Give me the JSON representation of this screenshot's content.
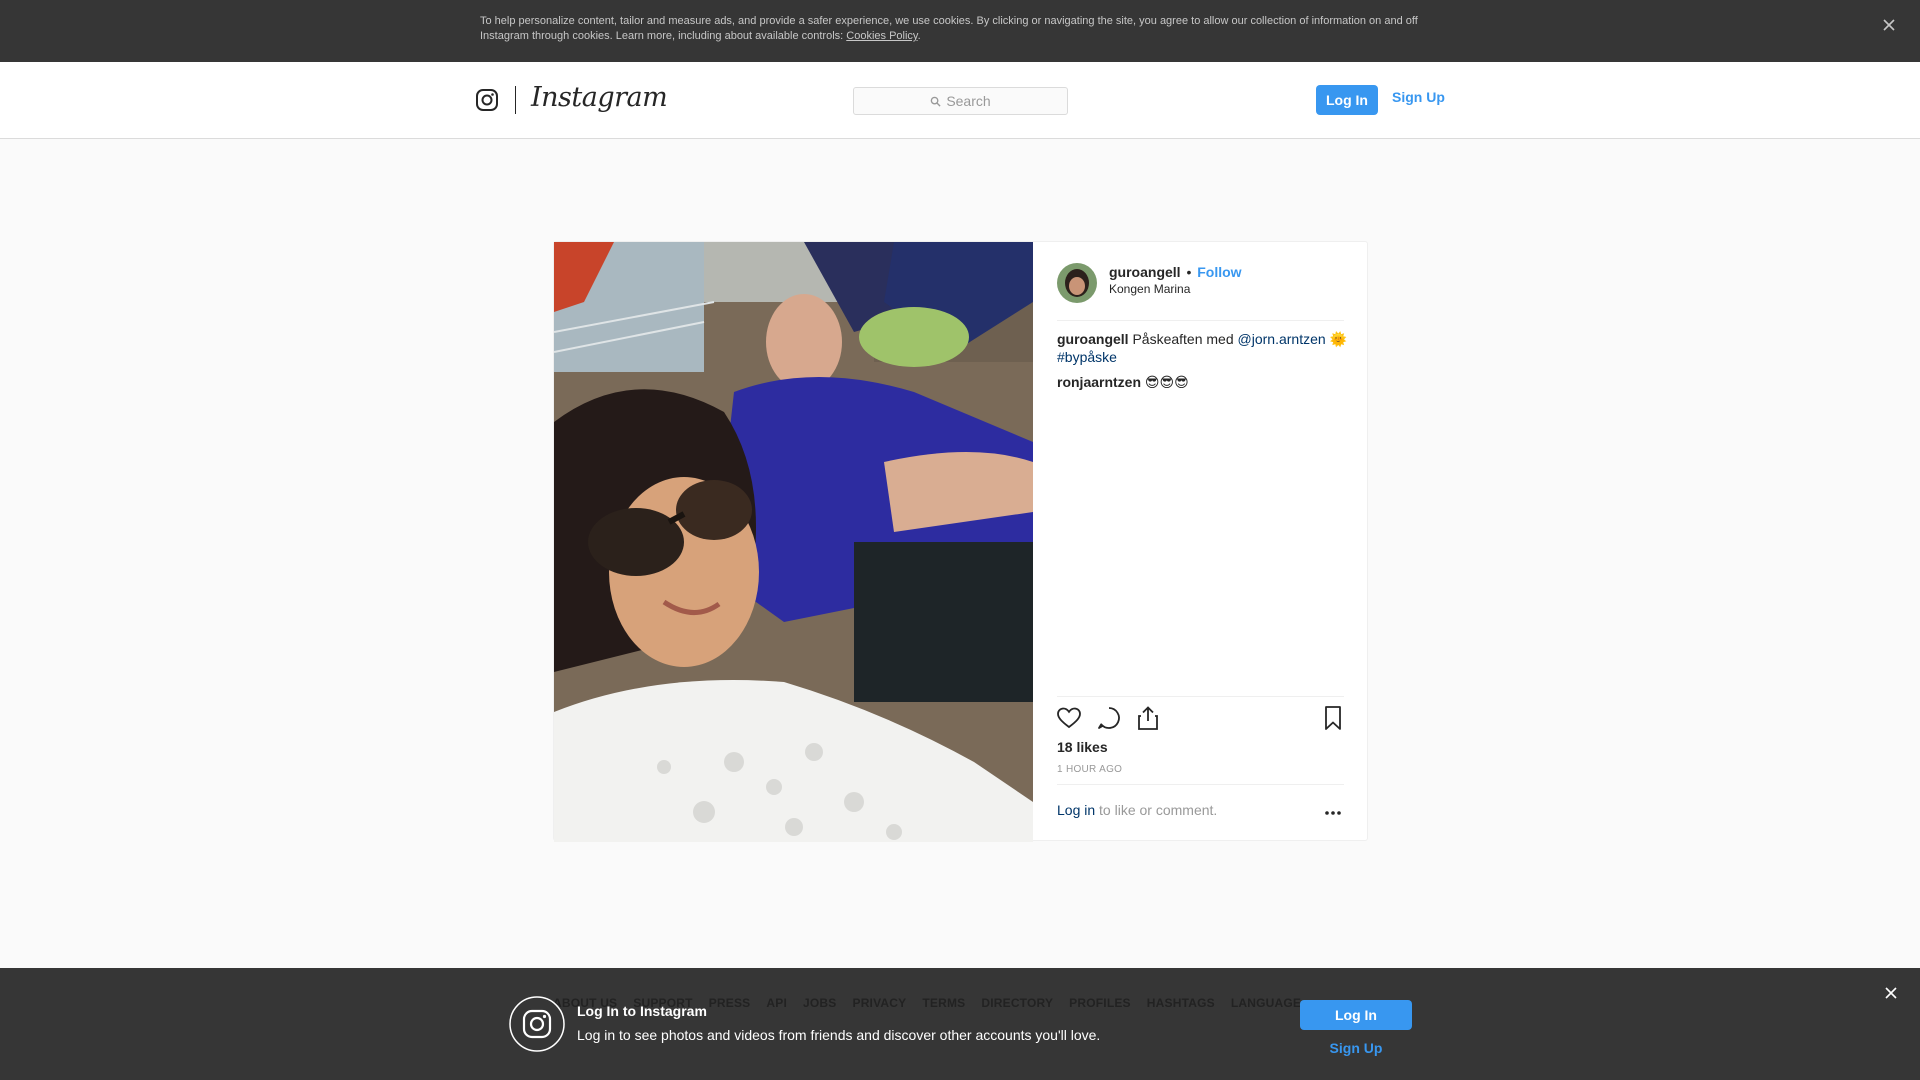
{
  "cookie_banner": {
    "text": "To help personalize content, tailor and measure ads, and provide a safer experience, we use cookies. By clicking or navigating the site, you agree to allow our collection of information on and off Instagram through cookies. Learn more, including about available controls: ",
    "link": "Cookies Policy",
    "period": ".",
    "close_icon": "close-icon"
  },
  "nav": {
    "logo_icon": "instagram-glyph-icon",
    "wordmark": "Instagram",
    "search_placeholder": "Search",
    "login_label": "Log In",
    "signup_label": "Sign Up"
  },
  "post": {
    "username": "guroangell",
    "separator": "•",
    "follow_label": "Follow",
    "location": "Kongen Marina",
    "caption": {
      "user": "guroangell",
      "text": "Påskeaften med",
      "mention": "@jorn.arntzen",
      "emoji": "🌞",
      "hashtag": "#bypåske"
    },
    "comment": {
      "user": "ronjaarntzen",
      "text": "😎😎😎"
    },
    "likes": "18 likes",
    "time": "1 HOUR AGO",
    "login_link": "Log in",
    "login_suffix": " to like or comment.",
    "more": "...",
    "actions": [
      "heart-icon",
      "comment-icon",
      "share-icon",
      "bookmark-icon"
    ]
  },
  "footer": {
    "links": [
      "ABOUT US",
      "SUPPORT",
      "PRESS",
      "API",
      "JOBS",
      "PRIVACY",
      "TERMS",
      "DIRECTORY",
      "PROFILES",
      "HASHTAGS",
      "LANGUAGE"
    ]
  },
  "login_banner": {
    "title": "Log In to Instagram",
    "subtitle": "Log in to see photos and videos from friends and discover other accounts you'll love.",
    "login_label": "Log In",
    "signup_label": "Sign Up"
  },
  "colors": {
    "accent": "#3897f0",
    "banner_bg": "#363636",
    "link_dark": "#003569"
  }
}
